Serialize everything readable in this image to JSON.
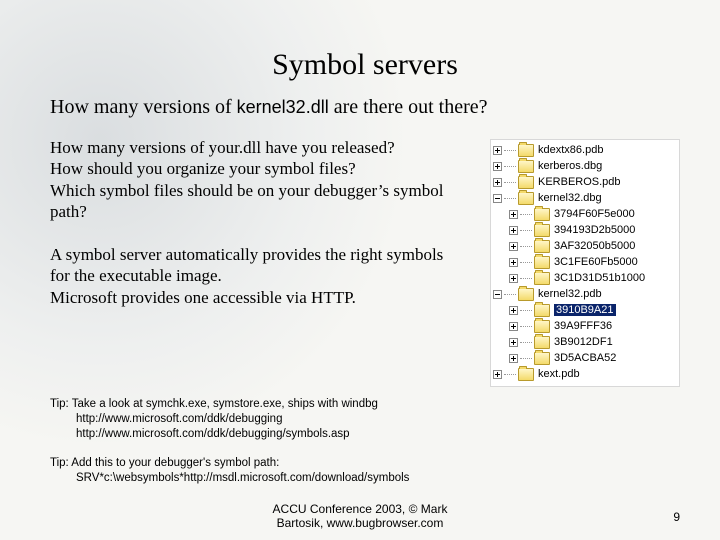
{
  "title": "Symbol servers",
  "subtitle_before": "How many versions of ",
  "subtitle_mono": "kernel32.dll",
  "subtitle_after": " are there out there?",
  "para1": "How many versions of your.dll have you released?\nHow should you organize your symbol files?\nWhich symbol files should be on your debugger’s symbol path?",
  "para2": "A symbol server automatically provides the right symbols for the executable image.\nMicrosoft provides one accessible via HTTP.",
  "tip1_lead": "Tip: Take a look at symchk.exe, symstore.exe, ships with windbg",
  "tip1_line2": "http://www.microsoft.com/ddk/debugging",
  "tip1_line3": "http://www.microsoft.com/ddk/debugging/symbols.asp",
  "tip2_lead": "Tip: Add this to your debugger's symbol path:",
  "tip2_line2": "SRV*c:\\websymbols*http://msdl.microsoft.com/download/symbols",
  "footer_line1": "ACCU Conference 2003, © Mark",
  "footer_line2": "Bartosik, www.bugbrowser.com",
  "page_number": "9",
  "tree": [
    {
      "indent": 0,
      "exp": "plus",
      "label": "kdextx86.pdb"
    },
    {
      "indent": 0,
      "exp": "plus",
      "label": "kerberos.dbg"
    },
    {
      "indent": 0,
      "exp": "plus",
      "label": "KERBEROS.pdb"
    },
    {
      "indent": 0,
      "exp": "minus",
      "label": "kernel32.dbg"
    },
    {
      "indent": 1,
      "exp": "plus",
      "label": "3794F60F5e000"
    },
    {
      "indent": 1,
      "exp": "plus",
      "label": "394193D2b5000"
    },
    {
      "indent": 1,
      "exp": "plus",
      "label": "3AF32050b5000"
    },
    {
      "indent": 1,
      "exp": "plus",
      "label": "3C1FE60Fb5000"
    },
    {
      "indent": 1,
      "exp": "plus",
      "label": "3C1D31D51b1000"
    },
    {
      "indent": 0,
      "exp": "minus",
      "label": "kernel32.pdb"
    },
    {
      "indent": 1,
      "exp": "plus",
      "label": "3910B9A21",
      "selected": true
    },
    {
      "indent": 1,
      "exp": "plus",
      "label": "39A9FFF36"
    },
    {
      "indent": 1,
      "exp": "plus",
      "label": "3B9012DF1"
    },
    {
      "indent": 1,
      "exp": "plus",
      "label": "3D5ACBA52"
    },
    {
      "indent": 0,
      "exp": "plus",
      "label": "kext.pdb"
    }
  ]
}
